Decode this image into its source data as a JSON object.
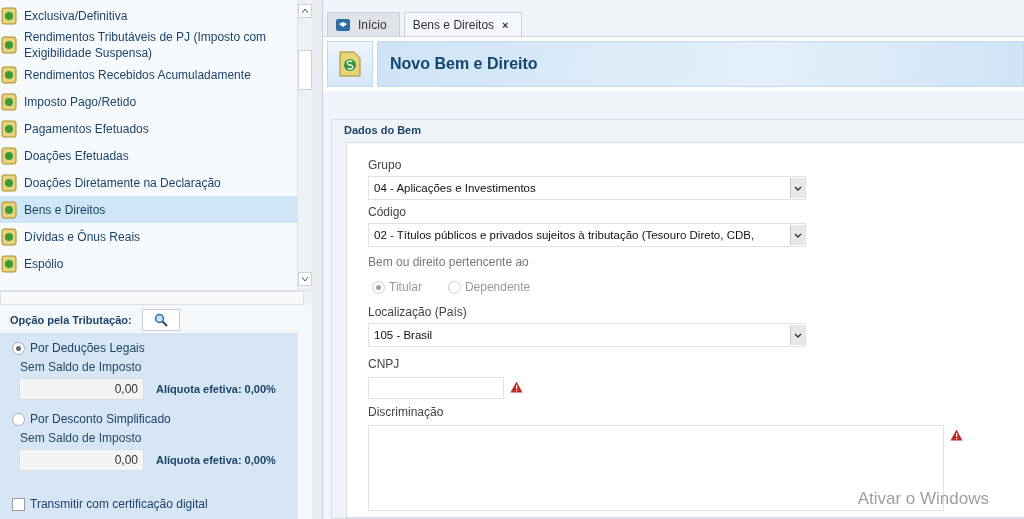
{
  "sidebar": {
    "items": [
      {
        "label": "Exclusiva/Definitiva",
        "selected": false
      },
      {
        "label": "Rendimentos Tributáveis de PJ (Imposto com Exigibilidade Suspensa)",
        "selected": false
      },
      {
        "label": "Rendimentos Recebidos Acumuladamente",
        "selected": false
      },
      {
        "label": "Imposto Pago/Retido",
        "selected": false
      },
      {
        "label": "Pagamentos Efetuados",
        "selected": false
      },
      {
        "label": "Doações Efetuadas",
        "selected": false
      },
      {
        "label": "Doações Diretamente na Declaração",
        "selected": false
      },
      {
        "label": "Bens e Direitos",
        "selected": true
      },
      {
        "label": "Dívidas e Ônus Reais",
        "selected": false
      },
      {
        "label": "Espólio",
        "selected": false
      }
    ]
  },
  "tax_option": {
    "title": "Opção pela Tributação:",
    "options": [
      {
        "label": "Por Deduções Legais",
        "selected": true,
        "status": "Sem Saldo de Imposto",
        "value": "0,00",
        "rate": "Alíquota efetiva: 0,00%"
      },
      {
        "label": "Por Desconto Simplificado",
        "selected": false,
        "status": "Sem Saldo de Imposto",
        "value": "0,00",
        "rate": "Alíquota efetiva: 0,00%"
      }
    ]
  },
  "certificate": {
    "label": "Transmitir com certificação digital",
    "checked": false
  },
  "tabs": [
    {
      "label": "Início",
      "selected": false,
      "closable": false
    },
    {
      "label": "Bens e Direitos",
      "selected": true,
      "closable": true,
      "close": "×"
    }
  ],
  "header": {
    "title": "Novo Bem e Direito"
  },
  "form": {
    "section": "Dados do Bem",
    "selects": [
      {
        "label": "Grupo",
        "value": "04 - Aplicações e Investimentos"
      },
      {
        "label": "Código",
        "value": "02 - Títulos públicos e privados sujeitos à tributação (Tesouro Direto, CDB,"
      }
    ],
    "owner": {
      "label": "Bem ou direito pertencente ao",
      "disabled": true,
      "options": [
        {
          "label": "Titular",
          "selected": true
        },
        {
          "label": "Dependente",
          "selected": false
        }
      ]
    },
    "location": {
      "label": "Localização (País)",
      "value": "105 - Brasil"
    },
    "cnpj": {
      "label": "CNPJ",
      "warning": true
    },
    "description": {
      "label": "Discriminação",
      "warning": true
    }
  },
  "watermark": {
    "text": "Ativar o Windows"
  }
}
